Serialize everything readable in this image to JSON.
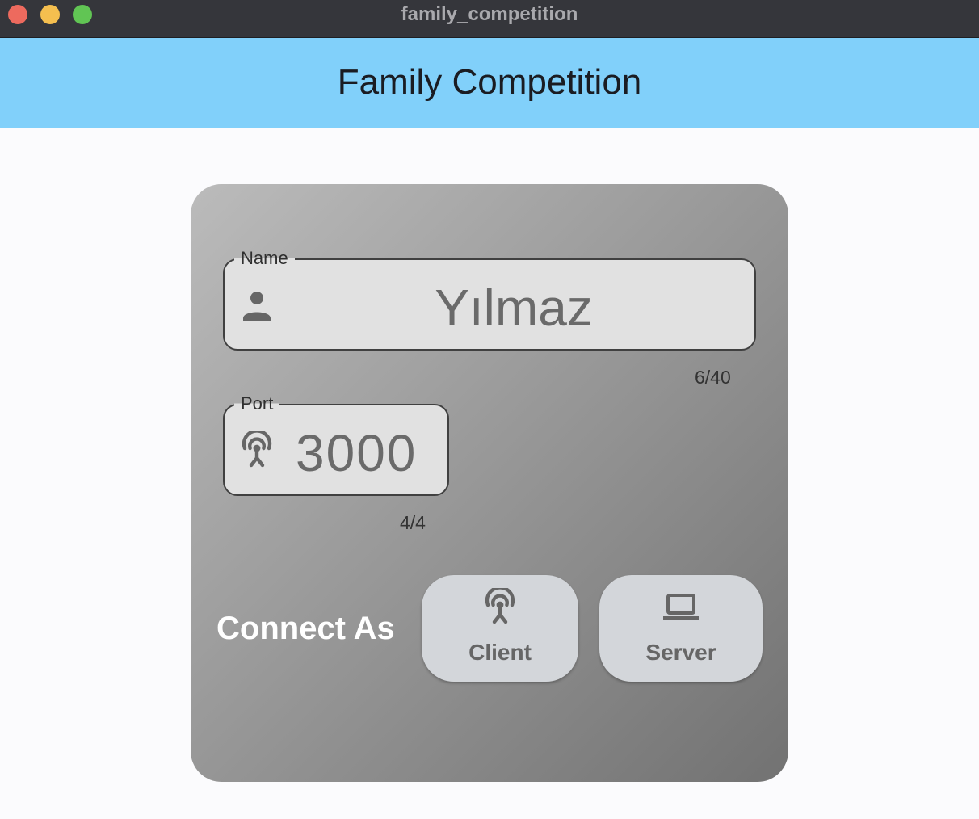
{
  "window": {
    "title": "family_competition"
  },
  "appbar": {
    "title": "Family Competition"
  },
  "form": {
    "name": {
      "label": "Name",
      "value": "Yılmaz",
      "counter": "6/40",
      "icon": "person-icon"
    },
    "port": {
      "label": "Port",
      "value": "3000",
      "counter": "4/4",
      "icon": "antenna-icon"
    },
    "connect_as_label": "Connect As",
    "buttons": [
      {
        "label": "Client",
        "icon": "antenna-icon"
      },
      {
        "label": "Server",
        "icon": "laptop-icon"
      }
    ]
  },
  "colors": {
    "titlebar": "#35363b",
    "appbar": "#81d0fa",
    "field_background": "#e1e1e1",
    "button_background": "#d3d6da",
    "traffic_red": "#ed6a5e",
    "traffic_yellow": "#f5bf4f",
    "traffic_green": "#61c554"
  }
}
